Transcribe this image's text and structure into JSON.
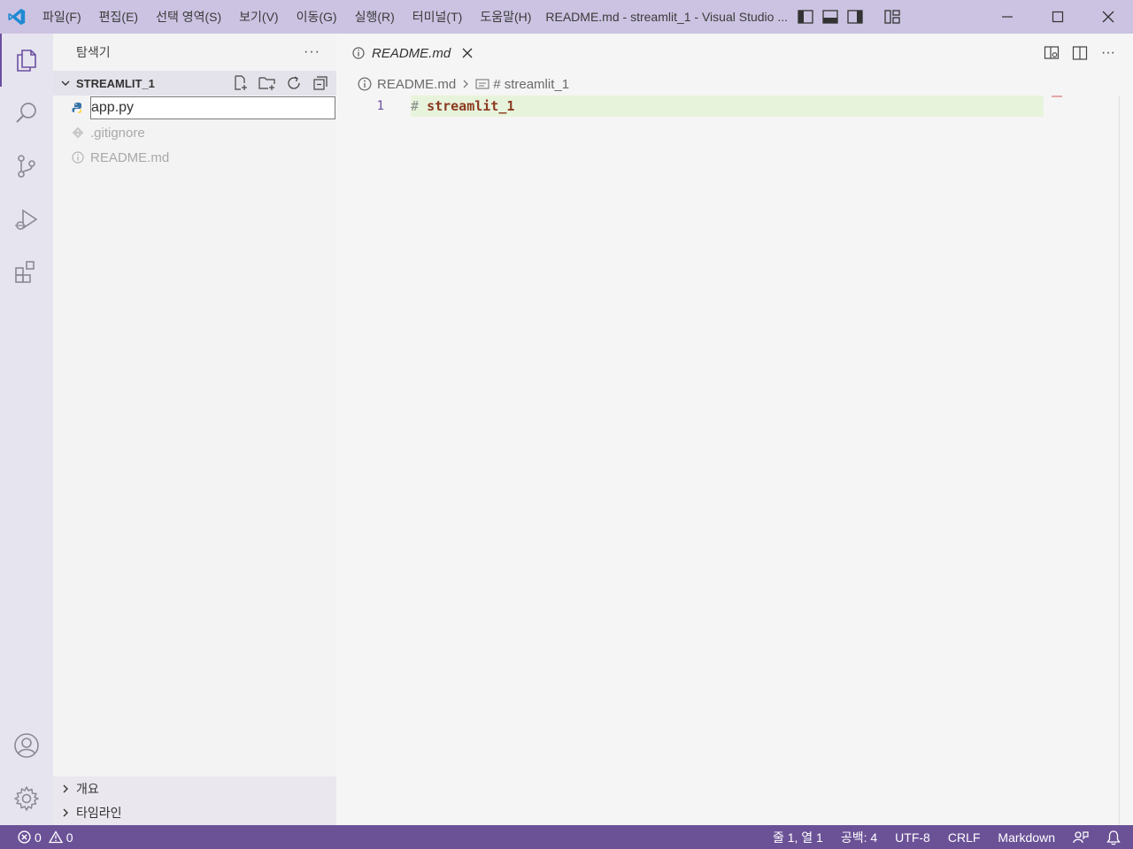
{
  "titlebar": {
    "menu": [
      "파일(F)",
      "편집(E)",
      "선택 영역(S)",
      "보기(V)",
      "이동(G)",
      "실행(R)",
      "터미널(T)",
      "도움말(H)"
    ],
    "window_title": "README.md - streamlit_1 - Visual Studio ..."
  },
  "sidebar": {
    "title": "탐색기",
    "folder_name": "STREAMLIT_1",
    "rename_value": "app.py",
    "files": [
      ".gitignore",
      "README.md"
    ],
    "sections": [
      "개요",
      "타임라인"
    ]
  },
  "editor": {
    "tab_label": "README.md",
    "breadcrumb": [
      "README.md",
      "# streamlit_1"
    ],
    "line_number": "1",
    "code_hash": "#",
    "code_heading": "streamlit_1"
  },
  "statusbar": {
    "errors": "0",
    "warnings": "0",
    "position": "줄 1, 열 1",
    "spaces": "공백: 4",
    "encoding": "UTF-8",
    "eol": "CRLF",
    "language": "Markdown"
  },
  "colors": {
    "titlebar": "#ccc3e2",
    "statusbar": "#6b5297",
    "accent": "#6b4fa0",
    "line_highlight": "#e8f3dc"
  }
}
